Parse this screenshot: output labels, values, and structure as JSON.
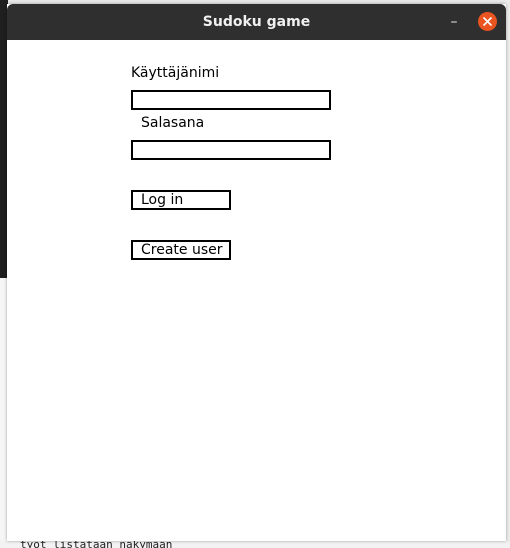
{
  "window": {
    "title": "Sudoku game",
    "minimize_symbol": "–",
    "close_icon": "close-icon",
    "titlebar_color": "#2f2f2f",
    "close_color": "#e95420"
  },
  "login_form": {
    "username_label": "Käyttäjänimi",
    "username_value": "",
    "password_label": "Salasana",
    "password_value": "",
    "login_button": "Log in",
    "create_user_button": "Create user"
  },
  "background": {
    "bottom_text": "työt listataan näkymään"
  }
}
